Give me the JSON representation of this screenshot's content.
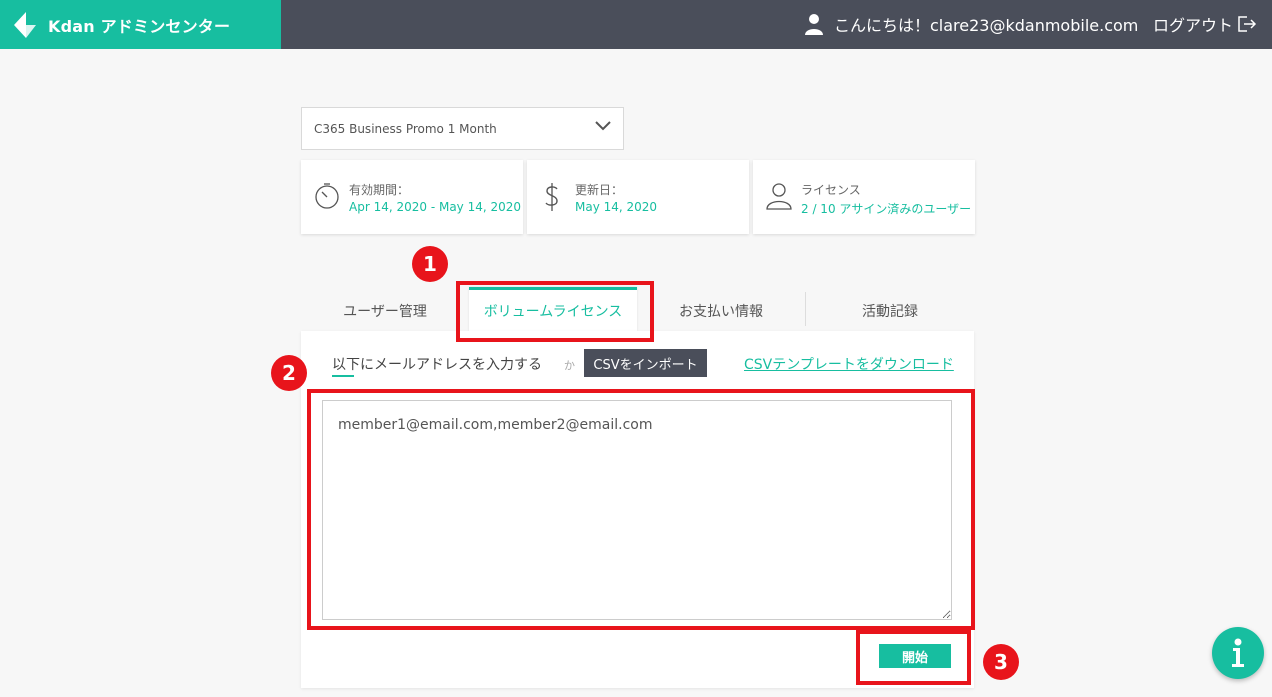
{
  "header": {
    "brand_title": "Kdan アドミンセンター",
    "greeting": "こんにちは！clare23@kdanmobile.com",
    "logout_label": "ログアウト"
  },
  "plan": {
    "selected": "C365 Business Promo 1 Month"
  },
  "cards": [
    {
      "label": "有効期間：",
      "value": "Apr 14, 2020 - May 14, 2020",
      "icon": "timer-icon"
    },
    {
      "label": "更新日：",
      "value": "May 14, 2020",
      "icon": "dollar-icon"
    },
    {
      "label": "ライセンス",
      "value": "2 / 10 アサイン済みのユーザー",
      "icon": "user-icon"
    }
  ],
  "tabs": [
    {
      "label": "ユーザー管理"
    },
    {
      "label": "ボリュームライセンス"
    },
    {
      "label": "お支払い情報"
    },
    {
      "label": "活動記録"
    }
  ],
  "import": {
    "email_mode_label": "以下にメールアドレスを入力する",
    "or_label": "か",
    "csv_mode_label": "CSVをインポート",
    "csv_template_link": "CSVテンプレートをダウンロード",
    "email_value": "member1@email.com,member2@email.com",
    "start_label": "開始"
  },
  "annotations": [
    "1",
    "2",
    "3"
  ],
  "colors": {
    "accent": "#17bea0",
    "header": "#4a4e5a",
    "highlight": "#e8141b"
  }
}
